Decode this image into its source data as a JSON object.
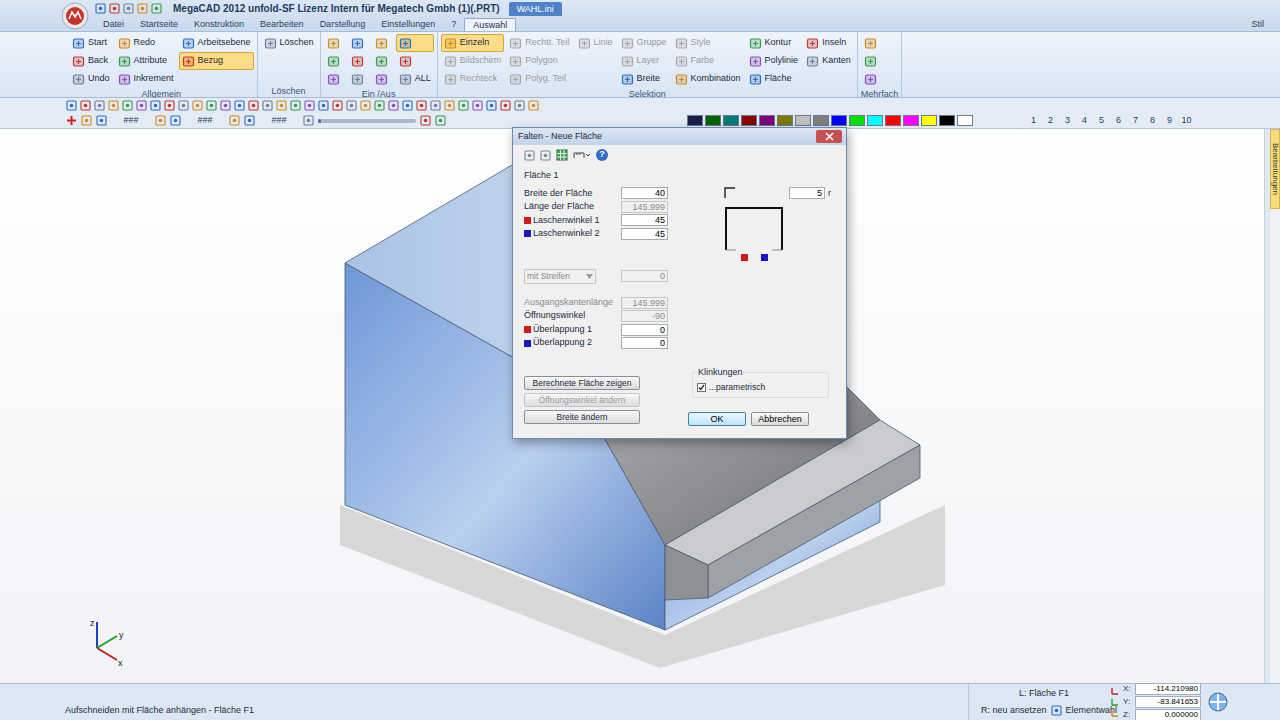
{
  "window": {
    "title": "MegaCAD 2012 unfold-SF  Lizenz Intern für Megatech Gmbh (1)(.PRT)",
    "context_tab": "WAHL.ini",
    "style_label": "Stil"
  },
  "menu_tabs": [
    {
      "label": "Datei",
      "selected": false
    },
    {
      "label": "Startseite",
      "selected": false
    },
    {
      "label": "Konstruktion",
      "selected": false
    },
    {
      "label": "Bearbeiten",
      "selected": false
    },
    {
      "label": "Darstellung",
      "selected": false
    },
    {
      "label": "Einstellungen",
      "selected": false
    },
    {
      "label": "?",
      "selected": false
    },
    {
      "label": "Auswahl",
      "selected": true
    }
  ],
  "ribbon": [
    {
      "title": "Allgemein",
      "columns": [
        [
          {
            "kind": "button",
            "label": "Start",
            "highlighted": false,
            "disabled": false
          },
          {
            "kind": "button",
            "label": "Back",
            "highlighted": false,
            "disabled": false
          },
          {
            "kind": "button",
            "label": "Undo",
            "highlighted": false,
            "disabled": false
          }
        ],
        [
          {
            "kind": "button",
            "label": "Redo",
            "highlighted": false,
            "disabled": false
          },
          {
            "kind": "button",
            "label": "Attribute",
            "highlighted": false,
            "disabled": false
          },
          {
            "kind": "button",
            "label": "Inkrement",
            "highlighted": false,
            "disabled": false
          }
        ],
        [
          {
            "kind": "button",
            "label": "Arbeitsebene",
            "highlighted": false,
            "disabled": false
          },
          {
            "kind": "button",
            "label": "Bezug",
            "highlighted": true,
            "disabled": false
          }
        ]
      ]
    },
    {
      "title": "Löschen",
      "columns": [
        [
          {
            "kind": "button",
            "label": "Löschen",
            "highlighted": false,
            "disabled": false
          }
        ]
      ]
    },
    {
      "title": "Ein /Aus",
      "columns": [
        [
          {
            "kind": "icon",
            "highlighted": false,
            "disabled": false
          },
          {
            "kind": "icon",
            "highlighted": false,
            "disabled": false
          },
          {
            "kind": "icon",
            "highlighted": false,
            "disabled": false
          }
        ],
        [
          {
            "kind": "icon",
            "highlighted": false,
            "disabled": false
          },
          {
            "kind": "icon",
            "highlighted": false,
            "disabled": false
          },
          {
            "kind": "icon",
            "highlighted": false,
            "disabled": false
          }
        ],
        [
          {
            "kind": "icon",
            "highlighted": false,
            "disabled": false
          },
          {
            "kind": "icon",
            "highlighted": false,
            "disabled": false
          },
          {
            "kind": "icon",
            "highlighted": false,
            "disabled": false
          }
        ],
        [
          {
            "kind": "icon",
            "highlighted": true,
            "disabled": false
          },
          {
            "kind": "icon",
            "highlighted": false,
            "disabled": false
          },
          {
            "kind": "button",
            "label": "ALL",
            "highlighted": false,
            "disabled": false
          }
        ]
      ]
    },
    {
      "title": "Selektion",
      "columns": [
        [
          {
            "kind": "button",
            "label": "Einzeln",
            "highlighted": true,
            "disabled": false
          },
          {
            "kind": "button",
            "label": "Bildschirm",
            "highlighted": false,
            "disabled": true
          },
          {
            "kind": "button",
            "label": "Rechteck",
            "highlighted": false,
            "disabled": true
          }
        ],
        [
          {
            "kind": "button",
            "label": "Rechtt. Teil",
            "highlighted": false,
            "disabled": true
          },
          {
            "kind": "button",
            "label": "Polygon",
            "highlighted": false,
            "disabled": true
          },
          {
            "kind": "button",
            "label": "Polyg. Teil",
            "highlighted": false,
            "disabled": true
          }
        ],
        [
          {
            "kind": "button",
            "label": "Linie",
            "highlighted": false,
            "disabled": true
          }
        ],
        [
          {
            "kind": "button",
            "label": "Gruppe",
            "highlighted": false,
            "disabled": true
          },
          {
            "kind": "button",
            "label": "Layer",
            "highlighted": false,
            "disabled": true
          },
          {
            "kind": "button",
            "label": "Breite",
            "highlighted": false,
            "disabled": false
          }
        ],
        [
          {
            "kind": "button",
            "label": "Style",
            "highlighted": false,
            "disabled": true
          },
          {
            "kind": "button",
            "label": "Farbe",
            "highlighted": false,
            "disabled": true
          },
          {
            "kind": "button",
            "label": "Kombination",
            "highlighted": false,
            "disabled": false
          }
        ],
        [
          {
            "kind": "button",
            "label": "Kontur",
            "highlighted": false,
            "disabled": false
          },
          {
            "kind": "button",
            "label": "Polylinie",
            "highlighted": false,
            "disabled": false
          },
          {
            "kind": "button",
            "label": "Fläche",
            "highlighted": false,
            "disabled": false
          }
        ],
        [
          {
            "kind": "button",
            "label": "Inseln",
            "highlighted": false,
            "disabled": false
          },
          {
            "kind": "button",
            "label": "Kanten",
            "highlighted": false,
            "disabled": false
          }
        ]
      ]
    },
    {
      "title": "Mehrfach",
      "columns": [
        [
          {
            "kind": "icon",
            "highlighted": false,
            "disabled": false
          },
          {
            "kind": "icon",
            "highlighted": false,
            "disabled": false
          },
          {
            "kind": "icon",
            "highlighted": false,
            "disabled": false
          }
        ]
      ]
    }
  ],
  "toolbar": {
    "fields": [
      "###",
      "###",
      "###"
    ],
    "slider": {
      "level": 0.03
    },
    "palette": [
      {
        "color": "#1c1c4a"
      },
      {
        "color": "#006400"
      },
      {
        "color": "#007b7b"
      },
      {
        "color": "#8b0000"
      },
      {
        "color": "#7b007b"
      },
      {
        "color": "#7b7b00"
      },
      {
        "color": "#c0c0c0"
      },
      {
        "color": "#7f7f7f"
      },
      {
        "color": "#0000ff"
      },
      {
        "color": "#00e000"
      },
      {
        "color": "#00ffff"
      },
      {
        "color": "#ff0000"
      },
      {
        "color": "#ff00ff"
      },
      {
        "color": "#ffff00"
      },
      {
        "color": "#000000"
      },
      {
        "color": "#ffffff"
      }
    ],
    "layers": [
      "1",
      "2",
      "3",
      "4",
      "5",
      "6",
      "7",
      "8",
      "9",
      "10"
    ]
  },
  "canvas": {
    "axes": [
      "x",
      "y",
      "z"
    ],
    "side_tab": "Bearbeitungen"
  },
  "dialog": {
    "title": "Falten - Neue Fläche",
    "help": "?",
    "section": "Fläche 1",
    "fields": [
      {
        "label": "Breite der Fläche",
        "value": "40",
        "disabled": false,
        "label_disabled": false
      },
      {
        "label": "Länge der Fläche",
        "value": "145.999",
        "disabled": true,
        "label_disabled": false
      },
      {
        "label": "Laschenwinkel 1",
        "value": "45",
        "disabled": false,
        "label_disabled": false,
        "color": "#d01818"
      },
      {
        "label": "Laschenwinkel 2",
        "value": "45",
        "disabled": false,
        "label_disabled": false,
        "color": "#1818c8"
      }
    ],
    "strip": {
      "option": "mit Streifen",
      "value": "0",
      "disabled": true
    },
    "fields2": [
      {
        "label": "Ausgangskantenlänge",
        "value": "145.999",
        "disabled": true,
        "label_disabled": true
      },
      {
        "label": "Öffnungswinkel",
        "value": "-90",
        "disabled": true,
        "label_disabled": false
      },
      {
        "label": "Überlappung 1",
        "value": "0",
        "disabled": false,
        "label_disabled": false,
        "color": "#d01818"
      },
      {
        "label": "Überlappung 2",
        "value": "0",
        "disabled": false,
        "label_disabled": false,
        "color": "#1818c8"
      }
    ],
    "preview": {
      "radius": "5",
      "unit": "r"
    },
    "buttons": [
      {
        "label": "Berechnete Fläche zeigen",
        "disabled": false
      },
      {
        "label": "Öffnungswinkel ändern",
        "disabled": true
      },
      {
        "label": "Breite ändern",
        "disabled": false
      }
    ],
    "klinkungen": {
      "title": "Klinkungen",
      "label": "...parametrisch",
      "checked": true
    },
    "ok": "OK",
    "cancel": "Abbrechen"
  },
  "status_bar": {
    "message": "Aufschneiden mit Fläche anhängen - Fläche F1",
    "left_mouse": "L: Fläche F1",
    "right_mouse": "R: neu ansetzen",
    "element_select": "Elementwahl",
    "coords": [
      {
        "axis": "X:",
        "value": "-114.210980"
      },
      {
        "axis": "Y:",
        "value": "-83.841653"
      },
      {
        "axis": "Z:",
        "value": "0.000000"
      }
    ]
  }
}
